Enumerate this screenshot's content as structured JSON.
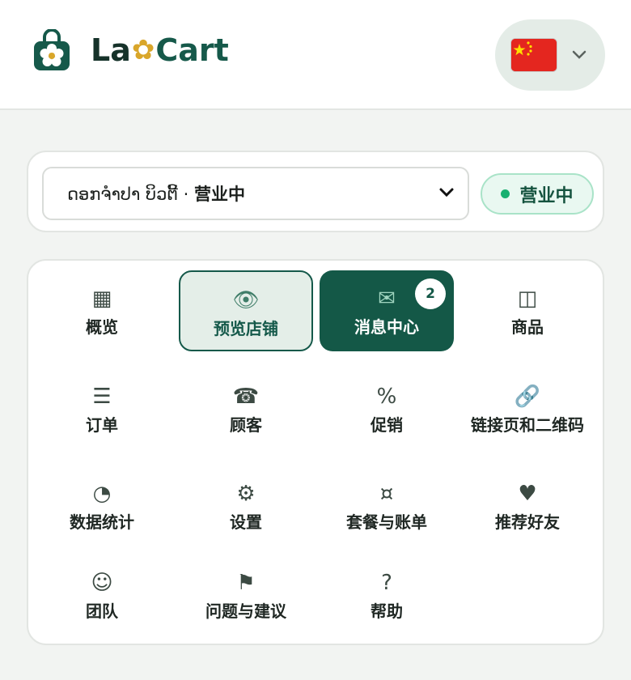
{
  "header": {
    "brand_part1": "La",
    "brand_star": "✿",
    "brand_part2": "Cart",
    "language": {
      "flag": "cn-flag",
      "chevron": "chevron-down-icon"
    }
  },
  "store": {
    "name": "ດອກຈຳປາ ບິວຕີ້",
    "separator": " · ",
    "status_inline": "营业中",
    "status_badge": "营业中",
    "status_color": "#18b070"
  },
  "colors": {
    "brand_dark": "#145847",
    "brand_accent": "#d9a62a",
    "background": "#f2f4f2"
  },
  "menu": {
    "items": [
      {
        "icon": "▦",
        "icon_name": "grid-icon",
        "label": "概览"
      },
      {
        "icon": "👁",
        "icon_name": "eye-icon",
        "label": "预览店铺"
      },
      {
        "icon": "✉",
        "icon_name": "mail-icon",
        "label": "消息中心",
        "badge": "2"
      },
      {
        "icon": "◫",
        "icon_name": "book-icon",
        "label": "商品"
      },
      {
        "icon": "☰",
        "icon_name": "list-icon",
        "label": "订单"
      },
      {
        "icon": "☎",
        "icon_name": "phone-icon",
        "label": "顾客"
      },
      {
        "icon": "%",
        "icon_name": "percent-icon",
        "label": "促销"
      },
      {
        "icon": "🔗",
        "icon_name": "link-icon",
        "label": "链接页和二维码"
      },
      {
        "icon": "◔",
        "icon_name": "pie-chart-icon",
        "label": "数据统计"
      },
      {
        "icon": "⚙",
        "icon_name": "gear-icon",
        "label": "设置"
      },
      {
        "icon": "¤",
        "icon_name": "currency-icon",
        "label": "套餐与账单"
      },
      {
        "icon": "♥",
        "icon_name": "heart-icon",
        "label": "推荐好友"
      },
      {
        "icon": "☺",
        "icon_name": "smiley-icon",
        "label": "团队"
      },
      {
        "icon": "⚑",
        "icon_name": "flag-icon",
        "label": "问题与建议"
      },
      {
        "icon": "?",
        "icon_name": "help-icon",
        "label": "帮助"
      }
    ]
  }
}
